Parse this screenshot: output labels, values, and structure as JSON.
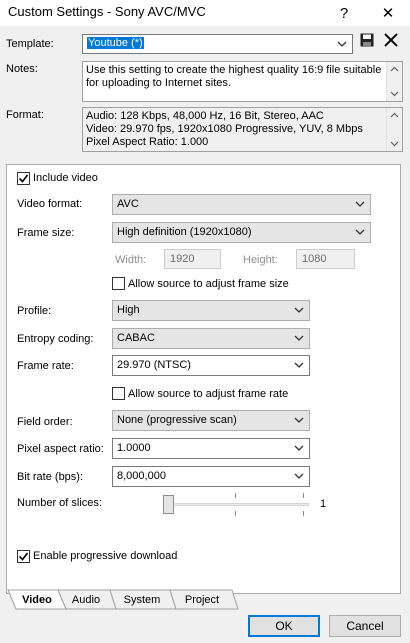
{
  "window": {
    "title": "Custom Settings - Sony AVC/MVC",
    "help_label": "?",
    "close_label": "✕"
  },
  "template": {
    "label": "Template:",
    "value": "Youtube (*)"
  },
  "notes": {
    "label": "Notes:",
    "lines": [
      "Use this setting to create the highest quality 16:9 file suitable",
      "for uploading to Internet sites."
    ]
  },
  "format": {
    "label": "Format:",
    "lines": [
      "Audio: 128 Kbps, 48,000 Hz, 16 Bit, Stereo, AAC",
      "Video: 29.970 fps, 1920x1080 Progressive, YUV, 8 Mbps",
      "Pixel Aspect Ratio: 1.000"
    ]
  },
  "video": {
    "include_video_label": "Include video",
    "include_video_checked": true,
    "video_format": {
      "label": "Video format:",
      "value": "AVC"
    },
    "frame_size": {
      "label": "Frame size:",
      "value": "High definition (1920x1080)"
    },
    "width": {
      "label": "Width:",
      "value": "1920"
    },
    "height": {
      "label": "Height:",
      "value": "1080"
    },
    "allow_frame_size": {
      "label": "Allow source to adjust frame size",
      "checked": false
    },
    "profile": {
      "label": "Profile:",
      "value": "High"
    },
    "entropy": {
      "label": "Entropy coding:",
      "value": "CABAC"
    },
    "frame_rate": {
      "label": "Frame rate:",
      "value": "29.970 (NTSC)"
    },
    "allow_frame_rate": {
      "label": "Allow source to adjust frame rate",
      "checked": false
    },
    "field_order": {
      "label": "Field order:",
      "value": "None (progressive scan)"
    },
    "pixel_aspect": {
      "label": "Pixel aspect ratio:",
      "value": "1.0000"
    },
    "bit_rate": {
      "label": "Bit rate (bps):",
      "value": "8,000,000"
    },
    "slices": {
      "label": "Number of slices:",
      "value": "1",
      "level": 0
    },
    "progressive_download": {
      "label": "Enable progressive download",
      "checked": true
    }
  },
  "tabs": [
    {
      "label": "Video",
      "active": true
    },
    {
      "label": "Audio",
      "active": false
    },
    {
      "label": "System",
      "active": false
    },
    {
      "label": "Project",
      "active": false
    }
  ],
  "buttons": {
    "ok": "OK",
    "cancel": "Cancel"
  },
  "icons": {
    "save": "save-icon",
    "delete": "delete-icon",
    "dropdown": "chevron-down-icon"
  }
}
